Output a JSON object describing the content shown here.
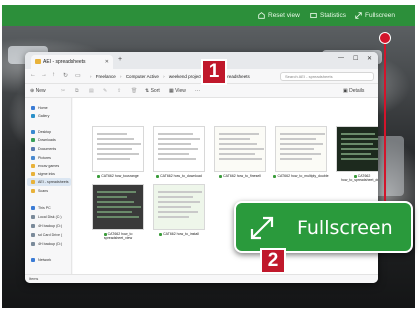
{
  "toolbar": {
    "reset_view_label": "Reset view",
    "statistics_label": "Statistics",
    "fullscreen_label": "Fullscreen"
  },
  "explorer": {
    "tab_label": "AEI - spreadsheets",
    "breadcrumb": [
      "Freelance",
      "Computer Active",
      "weekend project",
      "AEI - spreadsheets"
    ],
    "search_placeholder": "Search AEI - spreadsheets",
    "commands": {
      "new_label": "New",
      "sort_label": "Sort",
      "view_label": "View",
      "more_label": "···",
      "details_label": "Details"
    },
    "sidebar": [
      {
        "label": "Home",
        "icon": "home-icon",
        "color": "#3a7bd5"
      },
      {
        "label": "Gallery",
        "icon": "gallery-icon",
        "color": "#2a90c9"
      },
      {
        "label": "Desktop",
        "icon": "desktop-icon",
        "color": "#3a8ad0"
      },
      {
        "label": "Downloads",
        "icon": "downloads-icon",
        "color": "#3aa05a"
      },
      {
        "label": "Documents",
        "icon": "documents-icon",
        "color": "#5a7ab0"
      },
      {
        "label": "Pictures",
        "icon": "pictures-icon",
        "color": "#4a8ad0"
      },
      {
        "label": "excav games",
        "icon": "folder-icon",
        "color": "#e8b23a"
      },
      {
        "label": "sigme inks",
        "icon": "folder-icon",
        "color": "#e8b23a"
      },
      {
        "label": "AEI - spreadsheets",
        "icon": "folder-icon",
        "color": "#e8b23a",
        "selected": true
      },
      {
        "label": "Scans",
        "icon": "folder-icon",
        "color": "#e8b23a"
      },
      {
        "label": "This PC",
        "icon": "pc-icon",
        "color": "#3a7bd5"
      },
      {
        "label": "Local Disk (C:)",
        "icon": "drive-icon",
        "color": "#7a8a9a"
      },
      {
        "label": "4H backup (D:)",
        "icon": "drive-icon",
        "color": "#7a8a9a"
      },
      {
        "label": "sd Card Drive (",
        "icon": "drive-icon",
        "color": "#7a8a9a"
      },
      {
        "label": "4H backup (D:)",
        "icon": "drive-icon",
        "color": "#7a8a9a"
      },
      {
        "label": "Network",
        "icon": "network-icon",
        "color": "#3a7bd5"
      }
    ],
    "files": [
      {
        "name": "CAT662 how_tousrange",
        "theme": "light"
      },
      {
        "name": "CAT662 how_to_download",
        "theme": "light"
      },
      {
        "name": "CAT662 how_to_finesell",
        "theme": "doc"
      },
      {
        "name": "CAT662 how_to_multiply_double",
        "theme": "doc"
      },
      {
        "name": "CAT662 how_to_spreadsheet_drive",
        "theme": "dark"
      },
      {
        "name": "CAT662 how_to spreadsheet_view",
        "theme": "photo"
      },
      {
        "name": "CAT662 how_to_install",
        "theme": "green"
      }
    ],
    "status_text": "Items"
  },
  "badges": {
    "one": "1",
    "two": "2"
  },
  "callout": {
    "label": "Fullscreen"
  },
  "colors": {
    "toolbar_green": "#2c8f3a",
    "callout_green": "#2a9a3c",
    "badge_red": "#c0182b",
    "pointer_red": "#d3142b"
  }
}
